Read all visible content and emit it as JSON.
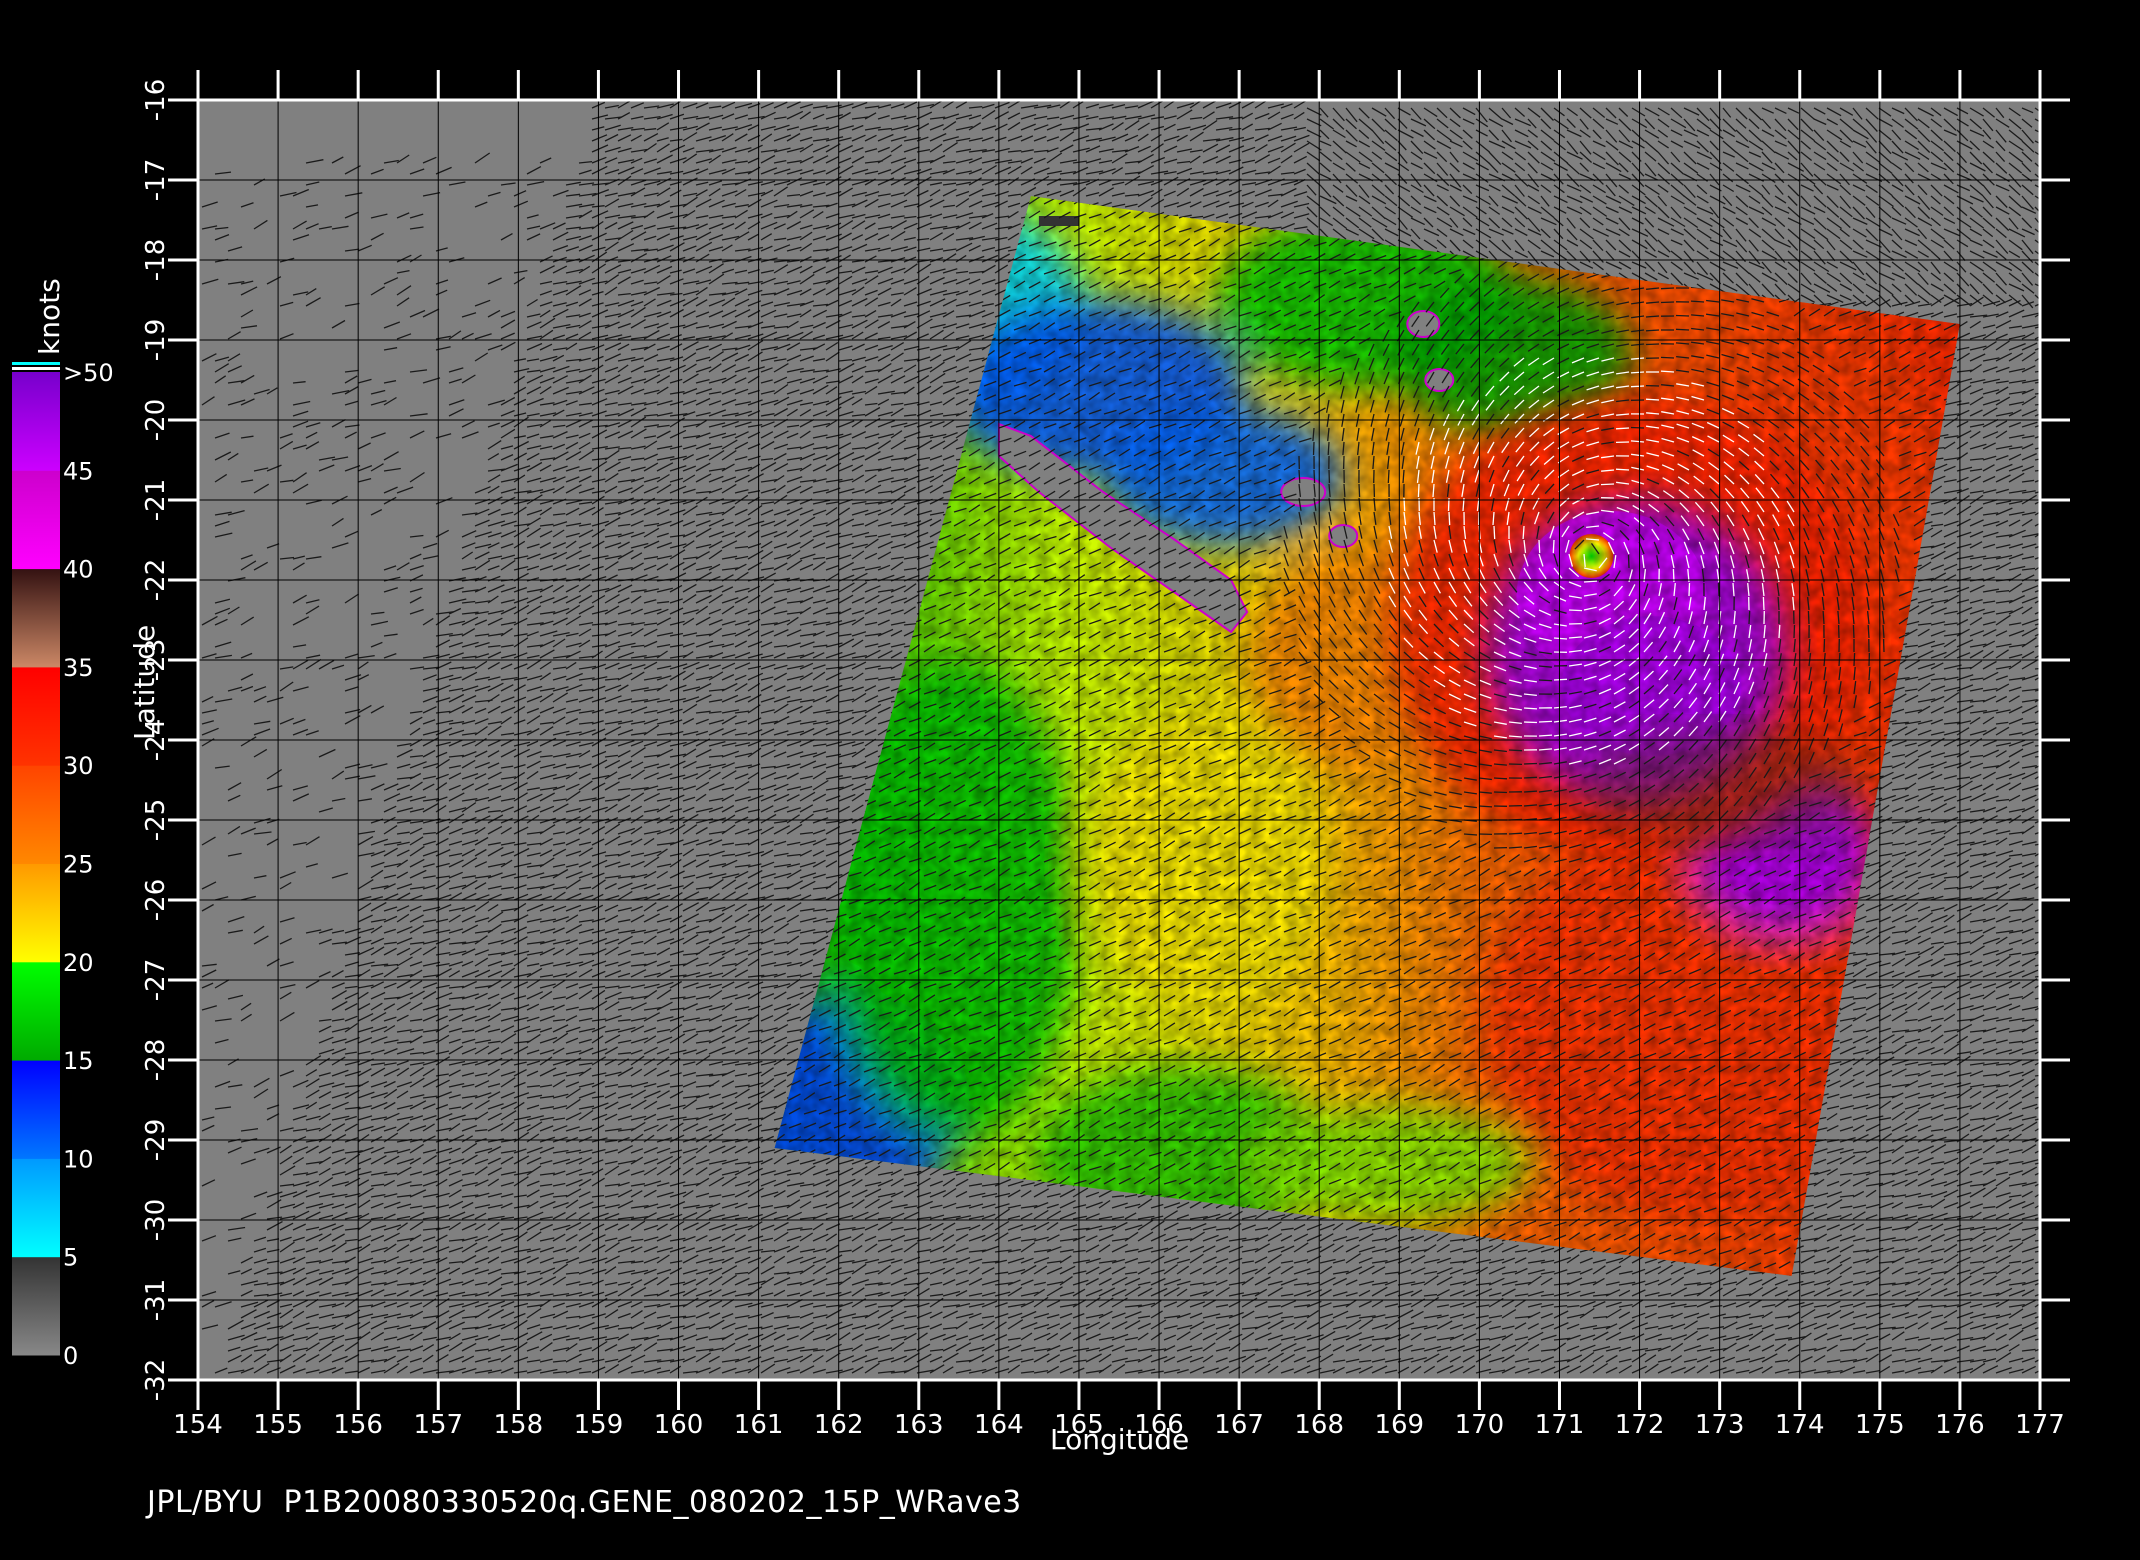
{
  "caption": "JPL/BYU  P1B20080330520q.GENE_080202_15P_WRave3",
  "chart_data": {
    "type": "heatmap",
    "title": "",
    "xlabel": "Longitude",
    "ylabel": "Latitude",
    "xlim": [
      154,
      177
    ],
    "ylim": [
      -32,
      -16
    ],
    "x_ticks": [
      "154",
      "155",
      "156",
      "157",
      "158",
      "159",
      "160",
      "161",
      "162",
      "163",
      "164",
      "165",
      "166",
      "167",
      "168",
      "169",
      "170",
      "171",
      "172",
      "173",
      "174",
      "175",
      "176",
      "177"
    ],
    "y_ticks": [
      "-16",
      "-17",
      "-18",
      "-19",
      "-20",
      "-21",
      "-22",
      "-23",
      "-24",
      "-25",
      "-26",
      "-27",
      "-28",
      "-29",
      "-30",
      "-31",
      "-32"
    ],
    "grid": true,
    "swath_corners_lonlat": [
      [
        164.4,
        -17.2
      ],
      [
        176.0,
        -18.8
      ],
      [
        173.9,
        -30.7
      ],
      [
        161.2,
        -29.1
      ]
    ],
    "storm_center_lonlat": [
      171.4,
      -21.7
    ],
    "colorbar": {
      "title": "knots",
      "labels": [
        "0",
        "5",
        "10",
        "15",
        "20",
        "25",
        "30",
        "35",
        "40",
        "45",
        ">50"
      ],
      "bands": [
        {
          "range": [
            0,
            5
          ],
          "colors": [
            "#888888",
            "#333333"
          ]
        },
        {
          "range": [
            5,
            10
          ],
          "colors": [
            "#00ffff",
            "#0099ff"
          ]
        },
        {
          "range": [
            10,
            15
          ],
          "colors": [
            "#0077ff",
            "#0000ff"
          ]
        },
        {
          "range": [
            15,
            20
          ],
          "colors": [
            "#00aa00",
            "#00ff00"
          ]
        },
        {
          "range": [
            20,
            25
          ],
          "colors": [
            "#ffff00",
            "#ff9900"
          ]
        },
        {
          "range": [
            25,
            30
          ],
          "colors": [
            "#ff8800",
            "#ff4400"
          ]
        },
        {
          "range": [
            30,
            35
          ],
          "colors": [
            "#ff3300",
            "#ff0000"
          ]
        },
        {
          "range": [
            35,
            40
          ],
          "colors": [
            "#cc8866",
            "#331111"
          ]
        },
        {
          "range": [
            40,
            45
          ],
          "colors": [
            "#ff00ff",
            "#cc00cc"
          ]
        },
        {
          "range": [
            45,
            50
          ],
          "colors": [
            "#cc00ff",
            "#7700cc"
          ]
        }
      ]
    },
    "colors": {
      "background": "#000000",
      "land_nodata": "#808080",
      "grid": "#000000",
      "frame": "#ffffff",
      "vectors_dark": "#1a1a1a",
      "vectors_light": "#ffffff"
    }
  }
}
